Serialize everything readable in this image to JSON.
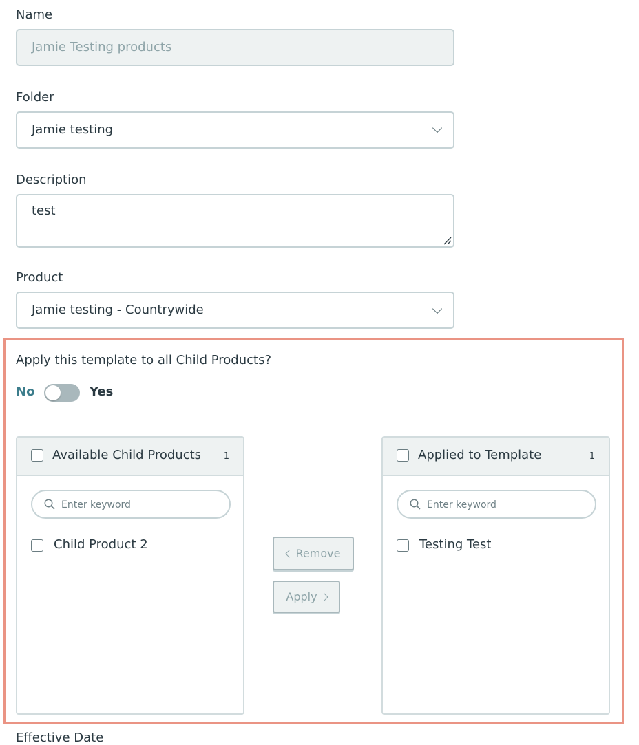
{
  "form": {
    "name_label": "Name",
    "name_value": "Jamie Testing products",
    "folder_label": "Folder",
    "folder_value": "Jamie testing",
    "description_label": "Description",
    "description_value": "test",
    "product_label": "Product",
    "product_value": "Jamie testing - Countrywide",
    "effective_date_label": "Effective Date"
  },
  "child_products": {
    "question": "Apply this template to all Child Products?",
    "toggle": {
      "off_label": "No",
      "on_label": "Yes",
      "value": "No"
    },
    "available": {
      "title": "Available Child Products",
      "count": "1",
      "search_placeholder": "Enter keyword",
      "items": [
        {
          "label": "Child Product 2"
        }
      ]
    },
    "applied": {
      "title": "Applied to Template",
      "count": "1",
      "search_placeholder": "Enter keyword",
      "items": [
        {
          "label": "Testing Test"
        }
      ]
    },
    "remove_label": "Remove",
    "apply_label": "Apply"
  },
  "colors": {
    "highlight_border": "#ea9484",
    "toggle_active_text": "#3c7d8c",
    "disabled_field_bg": "#eef2f2"
  },
  "icons": [
    "chevron-down-icon",
    "resize-grip-icon",
    "search-icon",
    "chevron-left-icon",
    "chevron-right-icon"
  ]
}
